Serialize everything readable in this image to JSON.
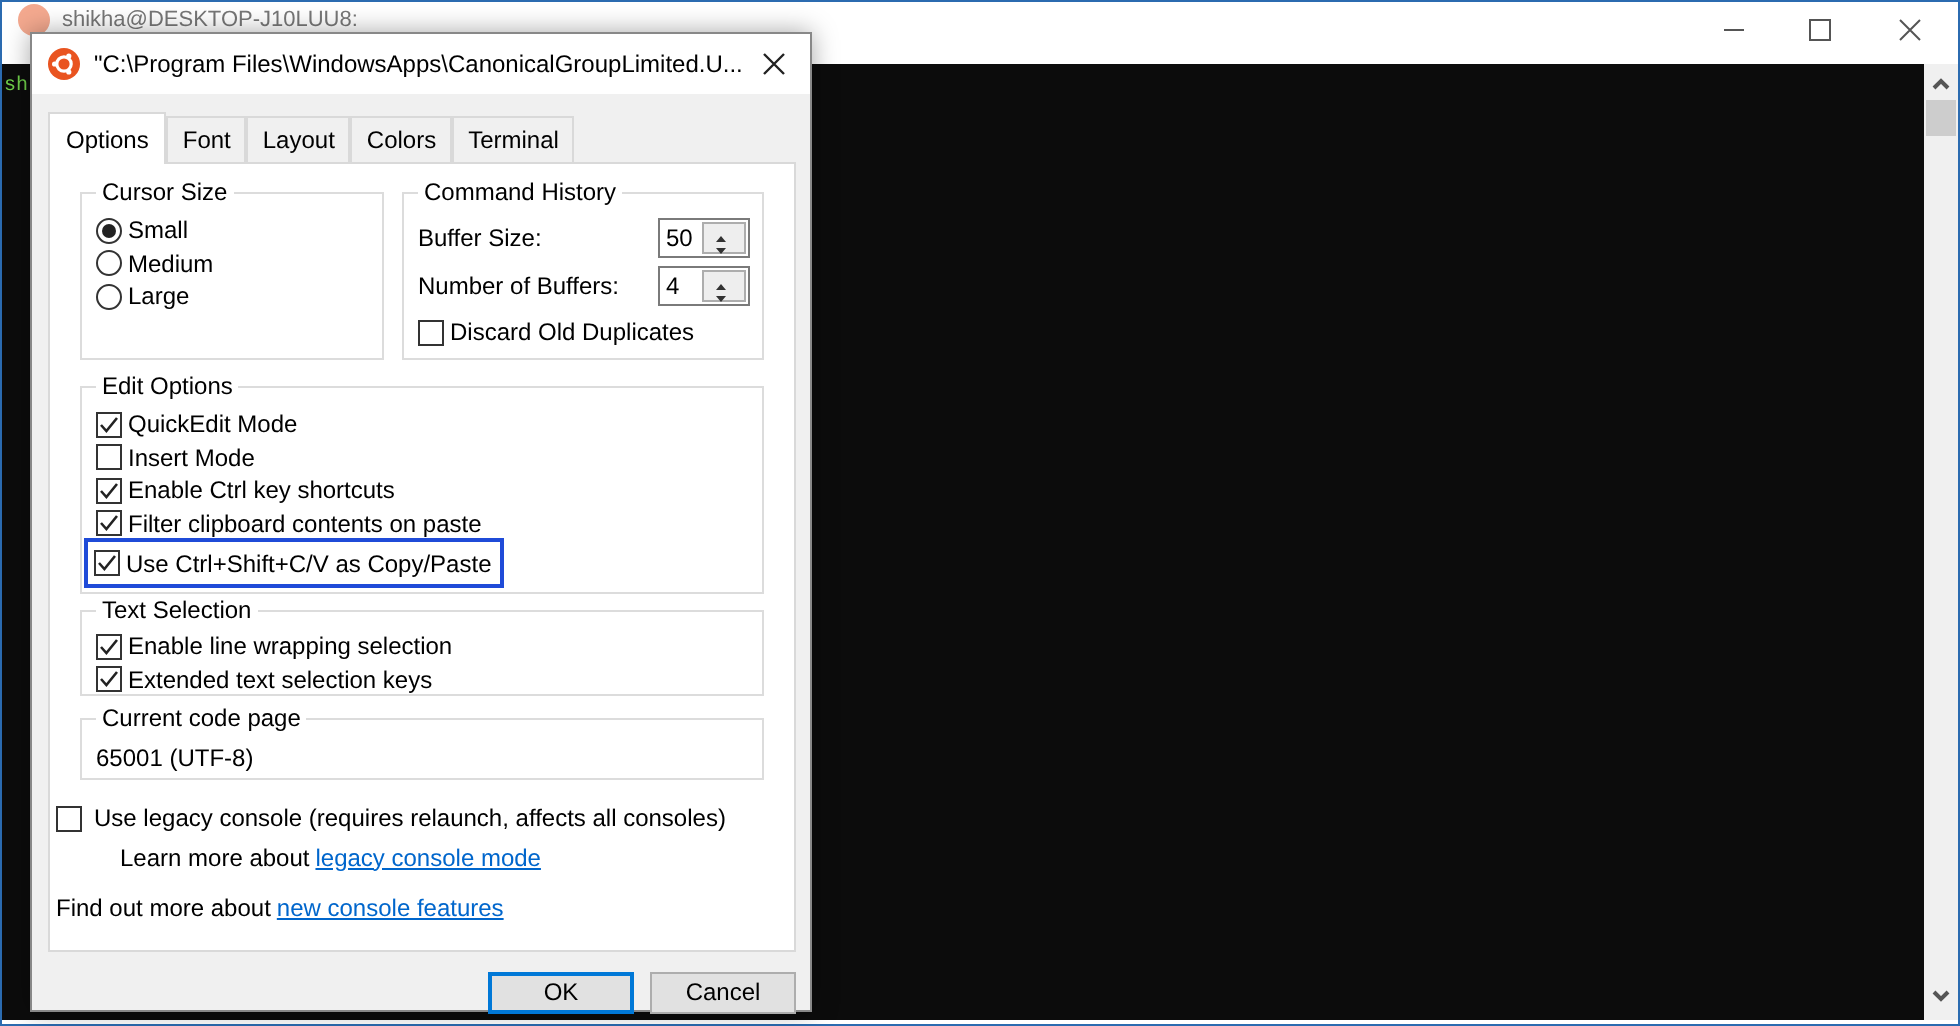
{
  "background_window": {
    "title": "shikha@DESKTOP-J10LUU8:",
    "terminal_text": "sh"
  },
  "dialog": {
    "title": "\"C:\\Program Files\\WindowsApps\\CanonicalGroupLimited.U...",
    "tabs": [
      {
        "label": "Options",
        "selected": true
      },
      {
        "label": "Font",
        "selected": false
      },
      {
        "label": "Layout",
        "selected": false
      },
      {
        "label": "Colors",
        "selected": false
      },
      {
        "label": "Terminal",
        "selected": false
      }
    ],
    "cursor_size": {
      "title": "Cursor Size",
      "options": [
        {
          "label": "Small",
          "selected": true
        },
        {
          "label": "Medium",
          "selected": false
        },
        {
          "label": "Large",
          "selected": false
        }
      ]
    },
    "command_history": {
      "title": "Command History",
      "fields": [
        {
          "label": "Buffer Size:",
          "value": "50"
        },
        {
          "label": "Number of Buffers:",
          "value": "4"
        }
      ],
      "discard": {
        "label": "Discard Old Duplicates",
        "checked": false
      }
    },
    "edit_options": {
      "title": "Edit Options",
      "items": [
        {
          "label": "QuickEdit Mode",
          "checked": true,
          "highlighted": false
        },
        {
          "label": "Insert Mode",
          "checked": false,
          "highlighted": false
        },
        {
          "label": "Enable Ctrl key shortcuts",
          "checked": true,
          "highlighted": false
        },
        {
          "label": "Filter clipboard contents on paste",
          "checked": true,
          "highlighted": false
        },
        {
          "label": "Use Ctrl+Shift+C/V as Copy/Paste",
          "checked": true,
          "highlighted": true
        }
      ]
    },
    "text_selection": {
      "title": "Text Selection",
      "items": [
        {
          "label": "Enable line wrapping selection",
          "checked": true
        },
        {
          "label": "Extended text selection keys",
          "checked": true
        }
      ]
    },
    "code_page": {
      "title": "Current code page",
      "value": "65001 (UTF-8)"
    },
    "legacy": {
      "label": "Use legacy console (requires relaunch, affects all consoles)",
      "checked": false,
      "note": "Learn more about",
      "link": "legacy console mode"
    },
    "features": {
      "text": "Find out more about",
      "link": "new console features"
    },
    "buttons": [
      {
        "label": "OK",
        "default": true
      },
      {
        "label": "Cancel",
        "default": false
      }
    ]
  }
}
